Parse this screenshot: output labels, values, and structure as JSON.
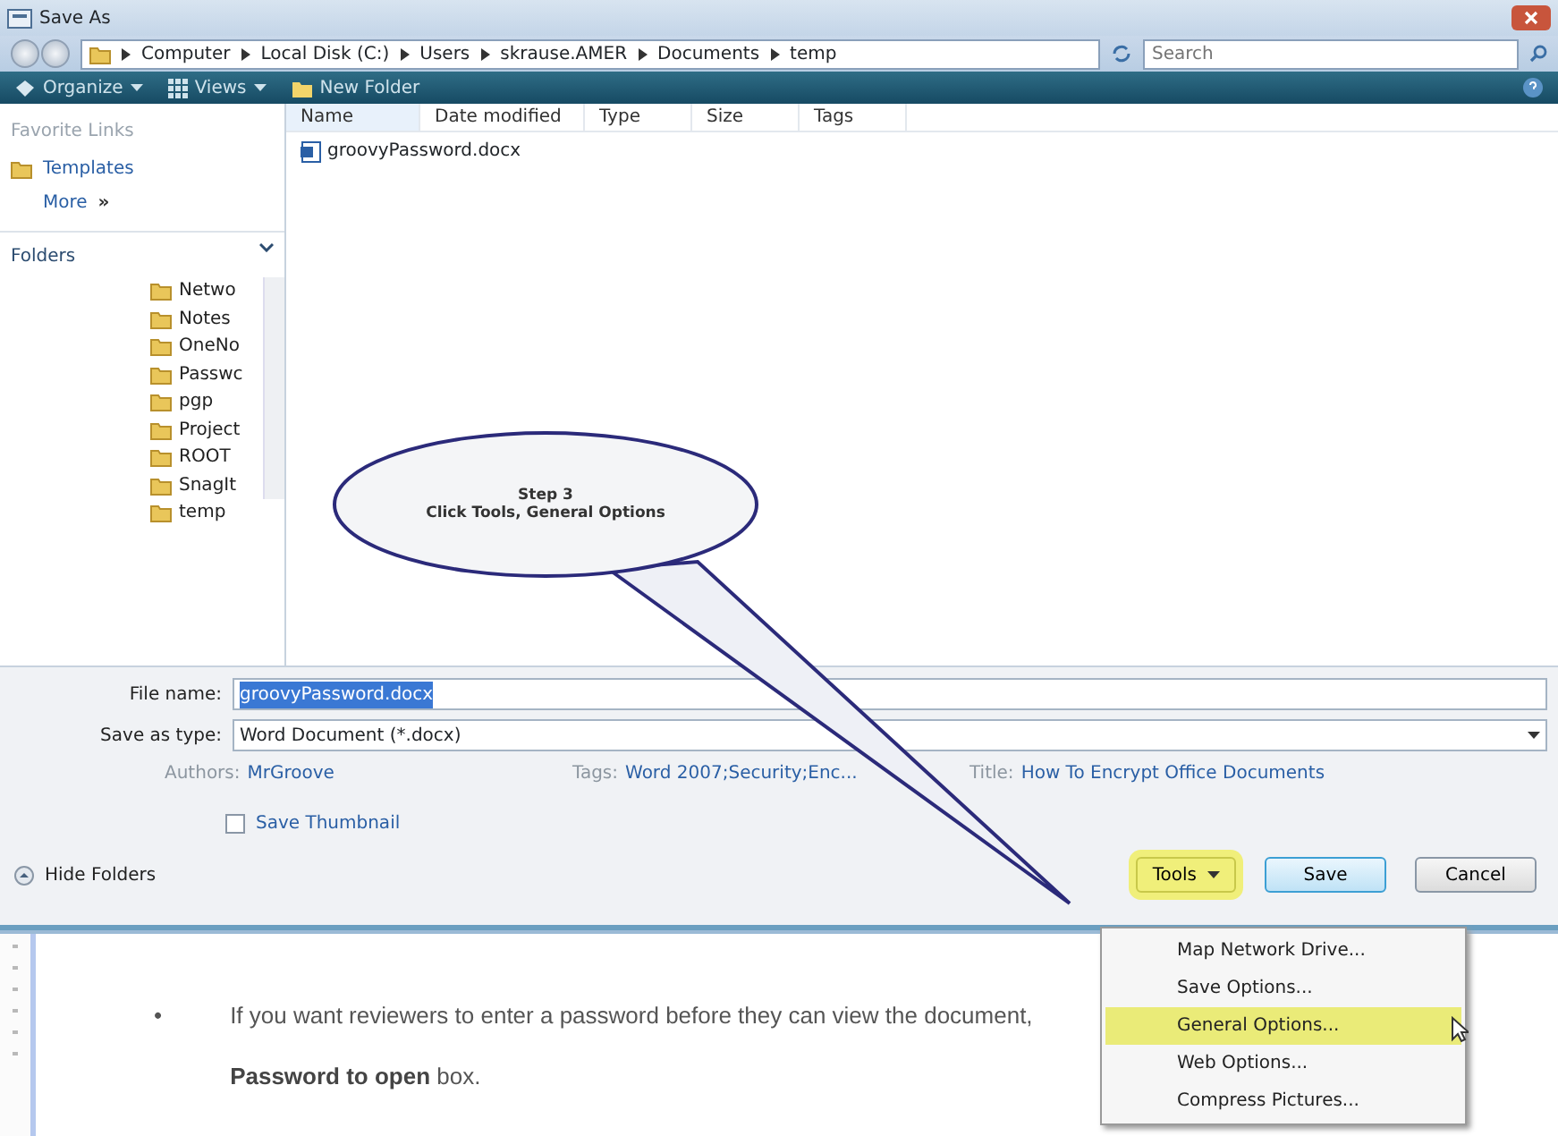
{
  "window": {
    "title": "Save As"
  },
  "address": {
    "crumbs": [
      "Computer",
      "Local Disk (C:)",
      "Users",
      "skrause.AMER",
      "Documents",
      "temp"
    ],
    "search_placeholder": "Search"
  },
  "toolbar": [
    {
      "label": "Organize",
      "dropdown": true
    },
    {
      "label": "Views",
      "dropdown": true
    },
    {
      "label": "New Folder",
      "dropdown": false
    }
  ],
  "favorite_links": {
    "title": "Favorite Links",
    "items": [
      {
        "label": "Templates",
        "kind": "folder"
      },
      {
        "label": "More",
        "glyph": "»",
        "kind": "more"
      }
    ]
  },
  "folders": {
    "title": "Folders",
    "items": [
      "Netwo",
      "Notes",
      "OneNo",
      "Passwc",
      "pgp",
      "Project",
      "ROOT",
      "SnagIt",
      "temp"
    ]
  },
  "columns": [
    "Name",
    "Date modified",
    "Type",
    "Size",
    "Tags"
  ],
  "files": [
    "groovyPassword.docx"
  ],
  "file_name": {
    "label": "File name:",
    "value": "groovyPassword.docx",
    "selected": true
  },
  "save_as_type": {
    "label": "Save as type:",
    "value": "Word Document (*.docx)"
  },
  "metadata": [
    {
      "label": "Authors:",
      "value": "MrGroove"
    },
    {
      "label": "Tags:",
      "value": "Word 2007;Security;Enc..."
    },
    {
      "label": "Title:",
      "value": "How To Encrypt Office Documents"
    }
  ],
  "save_thumbnail": {
    "label": "Save Thumbnail",
    "checked": false
  },
  "hide_folders": "Hide Folders",
  "buttons": [
    {
      "label": "Tools",
      "kind": "dropdown",
      "highlighted": true
    },
    {
      "label": "Save",
      "kind": "default",
      "highlighted": false
    },
    {
      "label": "Cancel",
      "kind": "plain",
      "highlighted": false
    }
  ],
  "callout": [
    "Step 3",
    "Click Tools, General Options"
  ],
  "menu": [
    {
      "label": "Map Network Drive...",
      "selected": false
    },
    {
      "label": "Save Options...",
      "selected": false
    },
    {
      "label": "General Options...",
      "selected": true
    },
    {
      "label": "Web Options...",
      "selected": false
    },
    {
      "label": "Compress Pictures...",
      "selected": false
    }
  ],
  "document": {
    "bullet": "•",
    "lines": [
      "If you want reviewers to enter a password before they can view the document,",
      "**Password to open** box."
    ]
  }
}
